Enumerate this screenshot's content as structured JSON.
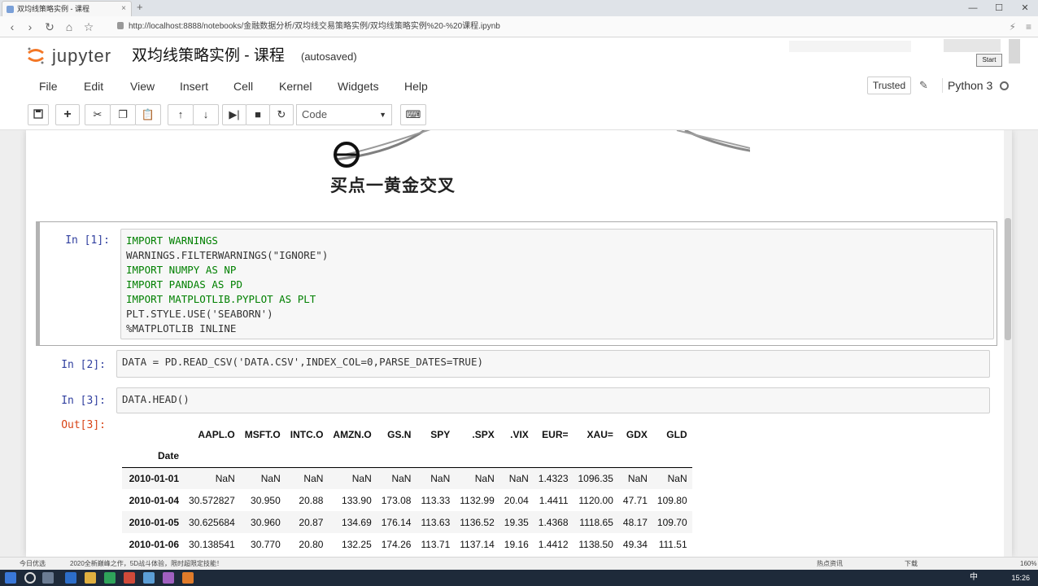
{
  "browser": {
    "tab_title": "双均线策略实例 - 课程",
    "url_text": "http://localhost:8888/notebooks/金融数据分析/双均线交易策略实例/双均线策略实例%20-%20课程.ipynb",
    "new_tab_glyph": "+"
  },
  "jupyter": {
    "logo_text": "jupyter",
    "notebook_title": "双均线策略实例 - 课程",
    "autosave_status": "(autosaved)",
    "overlay_button": "Start",
    "menu": [
      "File",
      "Edit",
      "View",
      "Insert",
      "Cell",
      "Kernel",
      "Widgets",
      "Help"
    ],
    "trusted_label": "Trusted",
    "kernel_name": "Python 3",
    "cell_type": "Code"
  },
  "markdown": {
    "caption": "买点一黄金交叉"
  },
  "cells": [
    {
      "prompt": "In  [1]:",
      "lines": [
        "IMPORT WARNINGS",
        "WARNINGS.FILTERWARNINGS(\"IGNORE\")",
        "IMPORT NUMPY AS NP",
        "IMPORT PANDAS AS PD",
        "IMPORT MATPLOTLIB.PYPLOT AS PLT",
        "PLT.STYLE.USE('SEABORN')",
        "%MATPLOTLIB INLINE"
      ]
    },
    {
      "prompt": "In  [2]:",
      "lines": [
        "DATA = PD.READ_CSV('DATA.CSV',INDEX_COL=0,PARSE_DATES=TRUE)"
      ]
    },
    {
      "prompt": "In  [3]:",
      "lines": [
        "DATA.HEAD()"
      ]
    }
  ],
  "output": {
    "prompt": "Out[3]:",
    "index_name": "Date",
    "columns": [
      "AAPL.O",
      "MSFT.O",
      "INTC.O",
      "AMZN.O",
      "GS.N",
      "SPY",
      ".SPX",
      ".VIX",
      "EUR=",
      "XAU=",
      "GDX",
      "GLD"
    ],
    "rows": [
      {
        "date": "2010-01-01",
        "values": [
          "NaN",
          "NaN",
          "NaN",
          "NaN",
          "NaN",
          "NaN",
          "NaN",
          "NaN",
          "1.4323",
          "1096.35",
          "NaN",
          "NaN"
        ]
      },
      {
        "date": "2010-01-04",
        "values": [
          "30.572827",
          "30.950",
          "20.88",
          "133.90",
          "173.08",
          "113.33",
          "1132.99",
          "20.04",
          "1.4411",
          "1120.00",
          "47.71",
          "109.80"
        ]
      },
      {
        "date": "2010-01-05",
        "values": [
          "30.625684",
          "30.960",
          "20.87",
          "134.69",
          "176.14",
          "113.63",
          "1136.52",
          "19.35",
          "1.4368",
          "1118.65",
          "48.17",
          "109.70"
        ]
      },
      {
        "date": "2010-01-06",
        "values": [
          "30.138541",
          "30.770",
          "20.80",
          "132.25",
          "174.26",
          "113.71",
          "1137.14",
          "19.16",
          "1.4412",
          "1138.50",
          "49.34",
          "111.51"
        ]
      }
    ]
  },
  "statusbar": {
    "left1": "今日优选",
    "left2": "2020全新巅峰之作，5D战斗体验，限时超限定技能！",
    "right1": "热点资讯",
    "right2": "下载",
    "zoom": "160%"
  },
  "taskbar": {
    "clock": "15:26",
    "ime": "中"
  },
  "colors": {
    "prompt_in": "#303f9f",
    "prompt_out": "#d84315",
    "keyword": "#008000",
    "string": "#ba2121"
  }
}
